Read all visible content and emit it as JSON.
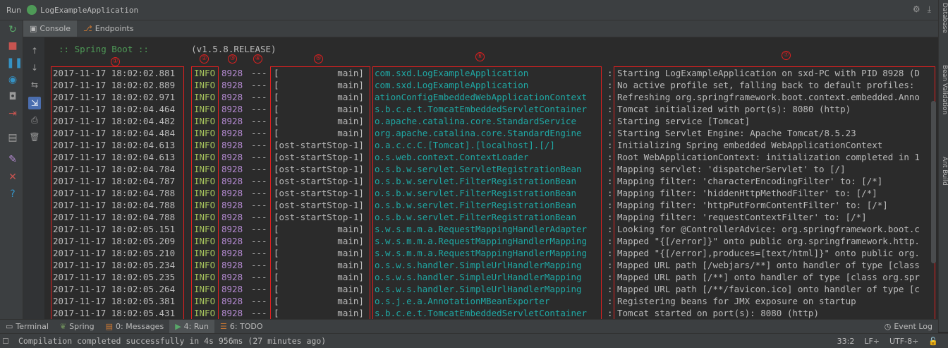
{
  "window": {
    "run_label": "Run",
    "app_name": "LogExampleApplication"
  },
  "tabs": [
    {
      "label": "Console",
      "icon": "console-icon"
    },
    {
      "label": "Endpoints",
      "icon": "endpoints-icon"
    }
  ],
  "banner": {
    "spring": ":: Spring Boot ::",
    "version": "(v1.5.8.RELEASE)"
  },
  "markers": [
    "①",
    "②",
    "③",
    "④",
    "⑤",
    "⑥",
    "⑦"
  ],
  "log": [
    {
      "ts": "2017-11-17 18:02:02.881",
      "level": "INFO",
      "pid": "8928",
      "sep": "---",
      "thread": "[           main]",
      "logger": "com.sxd.LogExampleApplication",
      "msg": "Starting LogExampleApplication on sxd-PC with PID 8928 (D"
    },
    {
      "ts": "2017-11-17 18:02:02.889",
      "level": "INFO",
      "pid": "8928",
      "sep": "---",
      "thread": "[           main]",
      "logger": "com.sxd.LogExampleApplication",
      "msg": "No active profile set, falling back to default profiles:"
    },
    {
      "ts": "2017-11-17 18:02:02.971",
      "level": "INFO",
      "pid": "8928",
      "sep": "---",
      "thread": "[           main]",
      "logger": "ationConfigEmbeddedWebApplicationContext",
      "msg": "Refreshing org.springframework.boot.context.embedded.Anno"
    },
    {
      "ts": "2017-11-17 18:02:04.464",
      "level": "INFO",
      "pid": "8928",
      "sep": "---",
      "thread": "[           main]",
      "logger": "s.b.c.e.t.TomcatEmbeddedServletContainer",
      "msg": "Tomcat initialized with port(s): 8080 (http)"
    },
    {
      "ts": "2017-11-17 18:02:04.482",
      "level": "INFO",
      "pid": "8928",
      "sep": "---",
      "thread": "[           main]",
      "logger": "o.apache.catalina.core.StandardService",
      "msg": "Starting service [Tomcat]"
    },
    {
      "ts": "2017-11-17 18:02:04.484",
      "level": "INFO",
      "pid": "8928",
      "sep": "---",
      "thread": "[           main]",
      "logger": "org.apache.catalina.core.StandardEngine",
      "msg": "Starting Servlet Engine: Apache Tomcat/8.5.23"
    },
    {
      "ts": "2017-11-17 18:02:04.613",
      "level": "INFO",
      "pid": "8928",
      "sep": "---",
      "thread": "[ost-startStop-1]",
      "logger": "o.a.c.c.C.[Tomcat].[localhost].[/]",
      "msg": "Initializing Spring embedded WebApplicationContext"
    },
    {
      "ts": "2017-11-17 18:02:04.613",
      "level": "INFO",
      "pid": "8928",
      "sep": "---",
      "thread": "[ost-startStop-1]",
      "logger": "o.s.web.context.ContextLoader",
      "msg": "Root WebApplicationContext: initialization completed in 1"
    },
    {
      "ts": "2017-11-17 18:02:04.784",
      "level": "INFO",
      "pid": "8928",
      "sep": "---",
      "thread": "[ost-startStop-1]",
      "logger": "o.s.b.w.servlet.ServletRegistrationBean",
      "msg": "Mapping servlet: 'dispatcherServlet' to [/]"
    },
    {
      "ts": "2017-11-17 18:02:04.787",
      "level": "INFO",
      "pid": "8928",
      "sep": "---",
      "thread": "[ost-startStop-1]",
      "logger": "o.s.b.w.servlet.FilterRegistrationBean",
      "msg": "Mapping filter: 'characterEncodingFilter' to: [/*]"
    },
    {
      "ts": "2017-11-17 18:02:04.788",
      "level": "INFO",
      "pid": "8928",
      "sep": "---",
      "thread": "[ost-startStop-1]",
      "logger": "o.s.b.w.servlet.FilterRegistrationBean",
      "msg": "Mapping filter: 'hiddenHttpMethodFilter' to: [/*]"
    },
    {
      "ts": "2017-11-17 18:02:04.788",
      "level": "INFO",
      "pid": "8928",
      "sep": "---",
      "thread": "[ost-startStop-1]",
      "logger": "o.s.b.w.servlet.FilterRegistrationBean",
      "msg": "Mapping filter: 'httpPutFormContentFilter' to: [/*]"
    },
    {
      "ts": "2017-11-17 18:02:04.788",
      "level": "INFO",
      "pid": "8928",
      "sep": "---",
      "thread": "[ost-startStop-1]",
      "logger": "o.s.b.w.servlet.FilterRegistrationBean",
      "msg": "Mapping filter: 'requestContextFilter' to: [/*]"
    },
    {
      "ts": "2017-11-17 18:02:05.151",
      "level": "INFO",
      "pid": "8928",
      "sep": "---",
      "thread": "[           main]",
      "logger": "s.w.s.m.m.a.RequestMappingHandlerAdapter",
      "msg": "Looking for @ControllerAdvice: org.springframework.boot.c"
    },
    {
      "ts": "2017-11-17 18:02:05.209",
      "level": "INFO",
      "pid": "8928",
      "sep": "---",
      "thread": "[           main]",
      "logger": "s.w.s.m.m.a.RequestMappingHandlerMapping",
      "msg": "Mapped \"{[/error]}\" onto public org.springframework.http."
    },
    {
      "ts": "2017-11-17 18:02:05.210",
      "level": "INFO",
      "pid": "8928",
      "sep": "---",
      "thread": "[           main]",
      "logger": "s.w.s.m.m.a.RequestMappingHandlerMapping",
      "msg": "Mapped \"{[/error],produces=[text/html]}\" onto public org."
    },
    {
      "ts": "2017-11-17 18:02:05.234",
      "level": "INFO",
      "pid": "8928",
      "sep": "---",
      "thread": "[           main]",
      "logger": "o.s.w.s.handler.SimpleUrlHandlerMapping",
      "msg": "Mapped URL path [/webjars/**] onto handler of type [class"
    },
    {
      "ts": "2017-11-17 18:02:05.235",
      "level": "INFO",
      "pid": "8928",
      "sep": "---",
      "thread": "[           main]",
      "logger": "o.s.w.s.handler.SimpleUrlHandlerMapping",
      "msg": "Mapped URL path [/**] onto handler of type [class org.spr"
    },
    {
      "ts": "2017-11-17 18:02:05.264",
      "level": "INFO",
      "pid": "8928",
      "sep": "---",
      "thread": "[           main]",
      "logger": "o.s.w.s.handler.SimpleUrlHandlerMapping",
      "msg": "Mapped URL path [/**/favicon.ico] onto handler of type [c"
    },
    {
      "ts": "2017-11-17 18:02:05.381",
      "level": "INFO",
      "pid": "8928",
      "sep": "---",
      "thread": "[           main]",
      "logger": "o.s.j.e.a.AnnotationMBeanExporter",
      "msg": "Registering beans for JMX exposure on startup"
    },
    {
      "ts": "2017-11-17 18:02:05.431",
      "level": "INFO",
      "pid": "8928",
      "sep": "---",
      "thread": "[           main]",
      "logger": "s.b.c.e.t.TomcatEmbeddedServletContainer",
      "msg": "Tomcat started on port(s): 8080 (http)"
    }
  ],
  "right_strip": [
    "Database",
    "Bean Validation",
    "Ant Build"
  ],
  "bottom_tabs": [
    {
      "label": "Terminal",
      "icon": "terminal-icon"
    },
    {
      "label": "Spring",
      "icon": "spring-icon"
    },
    {
      "label": "0: Messages",
      "icon": "messages-icon"
    },
    {
      "label": "4: Run",
      "icon": "run-icon"
    },
    {
      "label": "6: TODO",
      "icon": "todo-icon"
    }
  ],
  "event_log": "Event Log",
  "status": {
    "message": "Compilation completed successfully in 4s 956ms (27 minutes ago)",
    "position": "33:2",
    "line_sep": "LF÷",
    "encoding": "UTF-8÷"
  },
  "colors": {
    "red_annotation": "#e02020",
    "level_green": "#a5c25c",
    "pid_purple": "#b58bd3",
    "logger_teal": "#1fa9a5",
    "spring_green": "#4e9a57"
  }
}
